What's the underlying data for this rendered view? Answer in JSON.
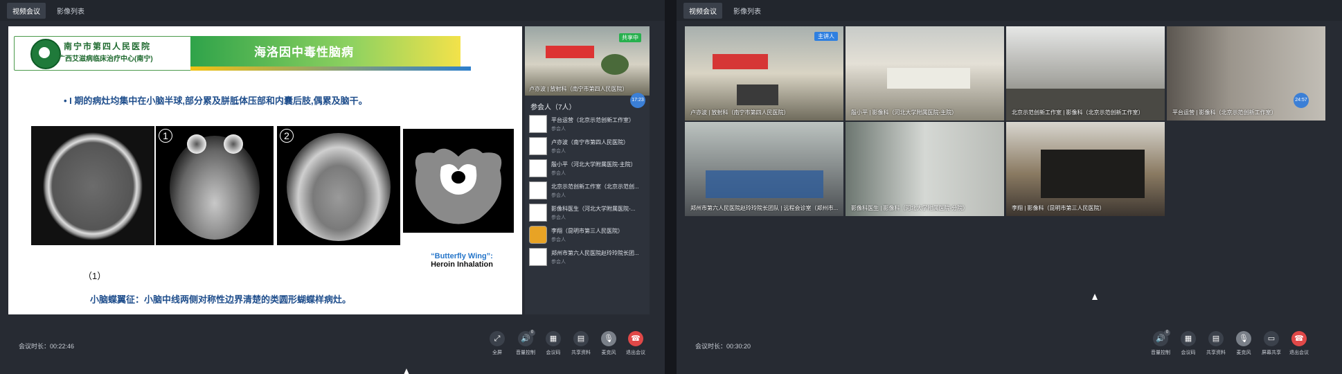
{
  "left": {
    "tabs": [
      "视频会议",
      "影像列表"
    ],
    "slide": {
      "hospital_name": "南宁市第四人民医院",
      "hospital_sub": "广西艾滋病临床治疗中心(南宁)",
      "title": "海洛因中毒性脑病",
      "bullet": "•    I 期的病灶均集中在小脑半球,部分累及胼胝体压部和内囊后肢,偶累及脑干。",
      "num1": "1",
      "num2": "2",
      "fig_label": "（1）",
      "butterfly_a": "“Butterfly Wing”:",
      "butterfly_b": "Heroin Inhalation",
      "bottom": "小脑蝶翼征：小脑中线两侧对称性边界清楚的类圆形蝴蝶样病灶。"
    },
    "side": {
      "share_badge": "共享中",
      "preview_label": "卢亦波 | 放射科（南宁市第四人民医院）",
      "mini_timer": "17:23",
      "title": "参会人（7人）",
      "participants": [
        {
          "name": "平台运营（北京示范创新工作室）",
          "role": "参会人"
        },
        {
          "name": "卢亦波（南宁市第四人民医院）",
          "role": "参会人"
        },
        {
          "name": "殷小平（河北大学附属医院-主院）",
          "role": "参会人"
        },
        {
          "name": "北京示范创新工作室（北京示范创...",
          "role": "参会人"
        },
        {
          "name": "影像科医生（河北大学附属医院-...",
          "role": "参会人"
        },
        {
          "name": "李翔（昆明市第三人民医院）",
          "role": "参会人"
        },
        {
          "name": "郑州市第六人民医院赵玲玲院长团...",
          "role": "参会人"
        }
      ]
    },
    "duration_label": "会议时长：00:22:46",
    "controls": [
      "全屏",
      "音量控制",
      "会议码",
      "共享资料",
      "麦克风",
      "退出会议"
    ],
    "volume_badge": "0"
  },
  "right": {
    "tabs": [
      "视频会议",
      "影像列表"
    ],
    "host_badge": "主讲人",
    "tile_timer": "24:57",
    "tiles": [
      "卢亦波 | 放射科（南宁市第四人民医院）",
      "殷小平 | 影像科（河北大学附属医院-主院）",
      "北京示范创新工作室 | 影像科（北京示范创新工作室）",
      "平台运营 | 影像科（北京示范创新工作室）",
      "郑州市第六人民医院赵玲玲院长团队 | 远程会诊室（郑州市...",
      "影像科医生 | 影像科（河北大学附属医院-分院）",
      "李翔 | 影像科（昆明市第三人民医院）"
    ],
    "duration_label": "会议时长：00:30:20",
    "controls": [
      "音量控制",
      "会议码",
      "共享资料",
      "麦克风",
      "屏幕共享",
      "退出会议"
    ],
    "volume_badge": "0"
  }
}
